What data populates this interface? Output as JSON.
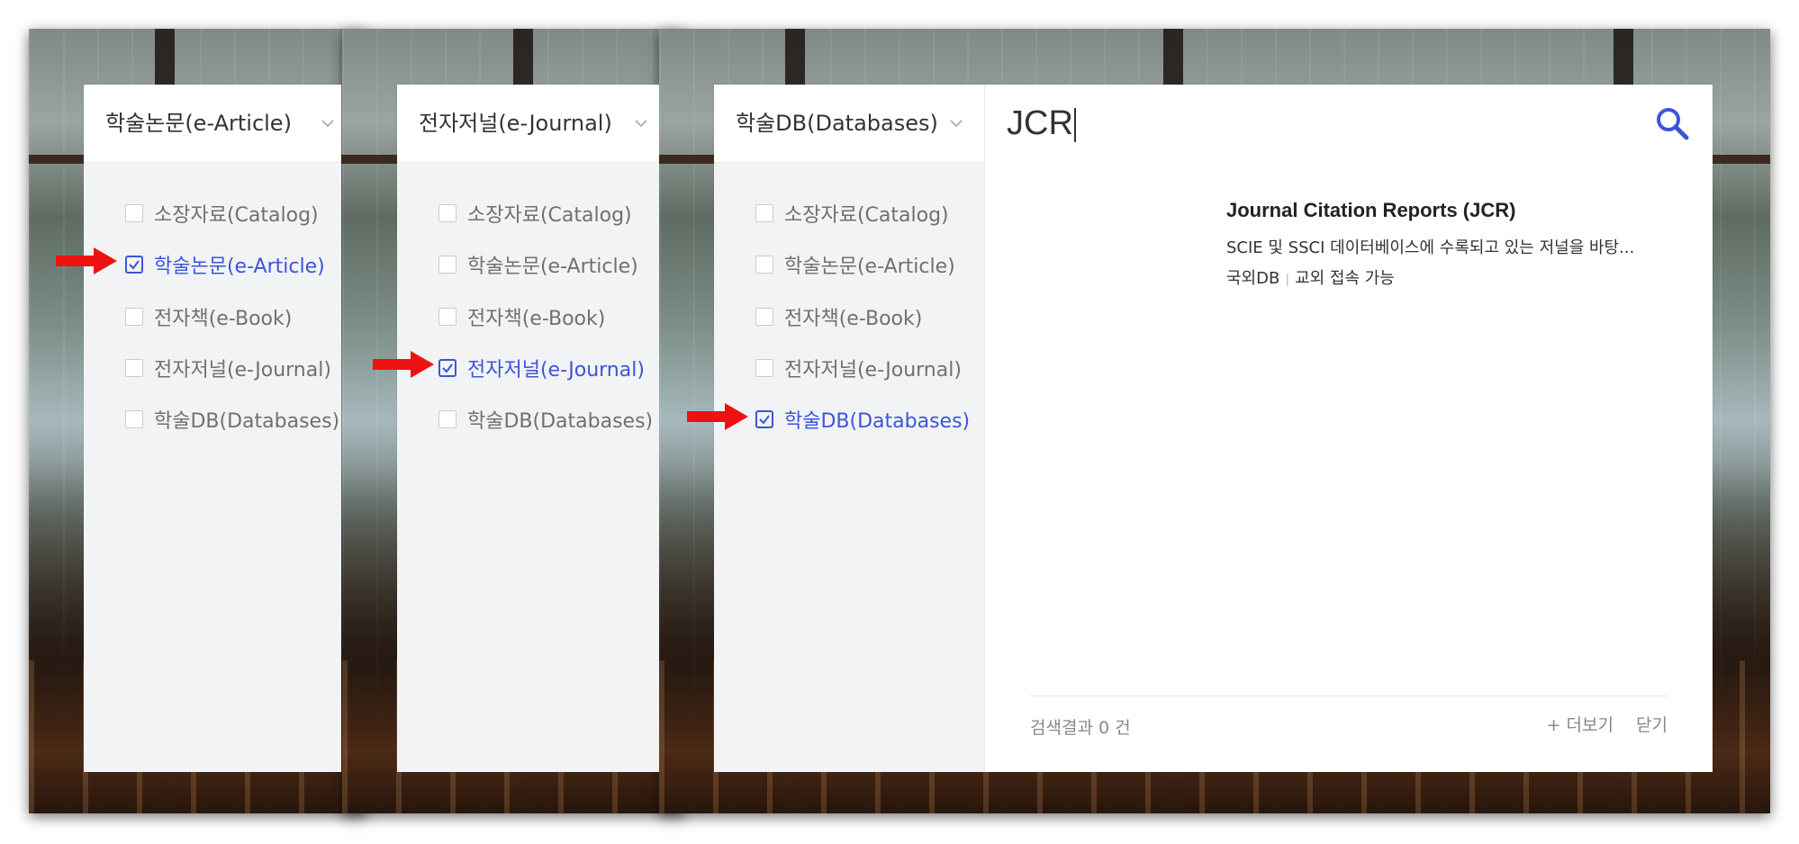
{
  "panels": [
    {
      "select_label": "학술논문(e-Article)",
      "options": [
        {
          "label": "소장자료(Catalog)",
          "checked": false
        },
        {
          "label": "학술논문(e-Article)",
          "checked": true
        },
        {
          "label": "전자책(e-Book)",
          "checked": false
        },
        {
          "label": "전자저널(e-Journal)",
          "checked": false
        },
        {
          "label": "학술DB(Databases)",
          "checked": false
        }
      ]
    },
    {
      "select_label": "전자저널(e-Journal)",
      "options": [
        {
          "label": "소장자료(Catalog)",
          "checked": false
        },
        {
          "label": "학술논문(e-Article)",
          "checked": false
        },
        {
          "label": "전자책(e-Book)",
          "checked": false
        },
        {
          "label": "전자저널(e-Journal)",
          "checked": true
        },
        {
          "label": "학술DB(Databases)",
          "checked": false
        }
      ]
    },
    {
      "select_label": "학술DB(Databases)",
      "options": [
        {
          "label": "소장자료(Catalog)",
          "checked": false
        },
        {
          "label": "학술논문(e-Article)",
          "checked": false
        },
        {
          "label": "전자책(e-Book)",
          "checked": false
        },
        {
          "label": "전자저널(e-Journal)",
          "checked": false
        },
        {
          "label": "학술DB(Databases)",
          "checked": true
        }
      ]
    }
  ],
  "search": {
    "query": "JCR"
  },
  "result": {
    "title": "Journal Citation Reports (JCR)",
    "description": "SCIE 및 SSCI 데이터베이스에 수록되고 있는 저널을 바탕...",
    "meta_1": "국외DB",
    "meta_2": "교외 접속 가능"
  },
  "footer": {
    "count_label": "검색결과 0 건",
    "more_label": "+ 더보기",
    "close_label": "닫기"
  },
  "colors": {
    "accent": "#3b55d9",
    "arrow": "#ee1111",
    "list_bg": "#f2f3f5"
  }
}
